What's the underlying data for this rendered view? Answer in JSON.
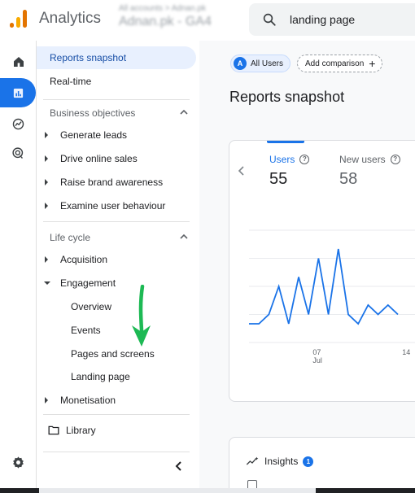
{
  "header": {
    "app_title": "Analytics",
    "account_line1": "All accounts > Adnan.pk",
    "account_line2": "Adnan.pk - GA4",
    "search_query": "landing page"
  },
  "rail": {
    "items": [
      {
        "icon": "home-icon"
      },
      {
        "icon": "reports-icon",
        "active": true
      },
      {
        "icon": "explore-icon"
      },
      {
        "icon": "advertising-icon"
      },
      {
        "icon": "settings-icon"
      }
    ]
  },
  "nav": {
    "reports_snapshot": "Reports snapshot",
    "realtime": "Real-time",
    "business_objectives": {
      "title": "Business objectives",
      "items": [
        "Generate leads",
        "Drive online sales",
        "Raise brand awareness",
        "Examine user behaviour"
      ]
    },
    "life_cycle": {
      "title": "Life cycle",
      "acquisition": "Acquisition",
      "engagement": "Engagement",
      "engagement_children": [
        "Overview",
        "Events",
        "Pages and screens",
        "Landing page"
      ],
      "monetisation": "Monetisation"
    },
    "library": "Library"
  },
  "main": {
    "chip_all_users_letter": "A",
    "chip_all_users": "All Users",
    "add_comparison": "Add comparison",
    "page_title": "Reports snapshot",
    "metrics": [
      {
        "label": "Users",
        "value": "55"
      },
      {
        "label": "New users",
        "value": "58"
      }
    ],
    "insights_label": "Insights",
    "insights_count": "1"
  },
  "colors": {
    "accent": "#1a73e8",
    "arrow": "#1db954",
    "logo_orange": "#e37400",
    "logo_yellow": "#f9ab00"
  },
  "chart_data": {
    "type": "line",
    "x_tick_labels": [
      "07\nJul",
      "14"
    ],
    "series": [
      {
        "values": [
          2,
          2,
          3,
          6,
          2,
          7,
          3,
          9,
          3,
          10,
          3,
          2,
          4,
          3,
          4,
          3
        ]
      }
    ],
    "grid": true,
    "ylim": [
      0,
      12
    ]
  }
}
